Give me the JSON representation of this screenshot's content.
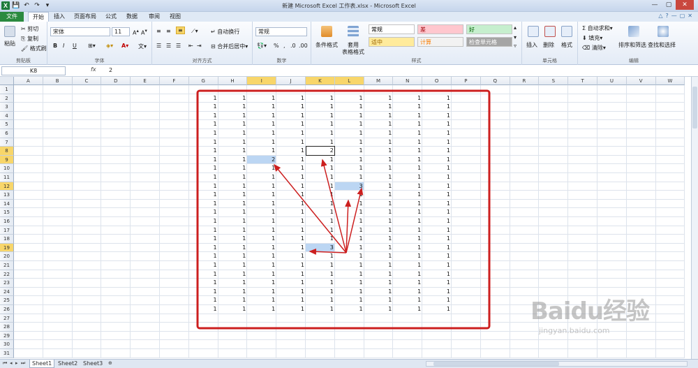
{
  "app": {
    "window_title": "新建 Microsoft Excel 工作表.xlsx - Microsoft Excel",
    "file_tab": "文件",
    "tabs": [
      "开始",
      "插入",
      "页面布局",
      "公式",
      "数据",
      "审阅",
      "视图"
    ],
    "active_tab": "开始"
  },
  "ribbon": {
    "clipboard": {
      "paste": "粘贴",
      "cut": "剪切",
      "copy": "复制",
      "format_painter": "格式刷",
      "label": "剪贴板"
    },
    "font": {
      "name": "宋体",
      "size": "11",
      "bold": "B",
      "italic": "I",
      "underline": "U",
      "label": "字体"
    },
    "alignment": {
      "wrap": "自动换行",
      "merge": "合并后居中",
      "label": "对齐方式"
    },
    "number": {
      "format": "常规",
      "percent": "%",
      "label": "数字"
    },
    "styles": {
      "conditional": "条件格式",
      "table_format_1": "套用",
      "table_format_2": "表格格式",
      "cells": [
        {
          "text": "常规",
          "bg": "#ffffff",
          "color": "#000000"
        },
        {
          "text": "差",
          "bg": "#ffc7ce",
          "color": "#9c0006"
        },
        {
          "text": "好",
          "bg": "#c6efce",
          "color": "#006100"
        },
        {
          "text": "适中",
          "bg": "#ffeb9c",
          "color": "#9c6500"
        },
        {
          "text": "计算",
          "bg": "#f2f2f2",
          "color": "#fa7d00"
        },
        {
          "text": "检查单元格",
          "bg": "#a5a5a5",
          "color": "#ffffff"
        }
      ],
      "label": "样式"
    },
    "cells_group": {
      "insert": "插入",
      "delete": "删除",
      "format": "格式",
      "label": "单元格"
    },
    "editing": {
      "autosum": "自动求和",
      "fill": "填充",
      "clear": "清除",
      "sort": "排序和筛选",
      "find": "查找和选择",
      "label": "编辑"
    }
  },
  "formula_bar": {
    "name_box": "K8",
    "fx": "fx",
    "value": "2"
  },
  "grid": {
    "columns": [
      "A",
      "B",
      "C",
      "D",
      "E",
      "F",
      "G",
      "H",
      "I",
      "J",
      "K",
      "L",
      "M",
      "N",
      "O",
      "P",
      "Q",
      "R",
      "S",
      "T",
      "U",
      "V",
      "W"
    ],
    "rows": 31,
    "selected_columns": [
      "I",
      "K",
      "L"
    ],
    "selected_rows": [
      8,
      9,
      12,
      19
    ],
    "fill_cols": [
      "G",
      "H",
      "I",
      "J",
      "K",
      "L",
      "M",
      "N",
      "O"
    ],
    "fill_rows_from": 2,
    "fill_rows_to": 26,
    "fill_value": "1",
    "special_cells": [
      {
        "ref": "K8",
        "value": "2",
        "active": true
      },
      {
        "ref": "I9",
        "value": "2",
        "highlight": true
      },
      {
        "ref": "L12",
        "value": "3",
        "highlight": true
      },
      {
        "ref": "K19",
        "value": "3",
        "highlight": true
      }
    ]
  },
  "sheets": [
    "Sheet1",
    "Sheet2",
    "Sheet3"
  ],
  "colors": {
    "annotation": "#cc1f1f",
    "highlight": "#bcd6f3",
    "header_selected": "#f8d66a"
  },
  "watermark": {
    "brand": "Baidu经验",
    "url": "jingyan.baidu.com"
  }
}
